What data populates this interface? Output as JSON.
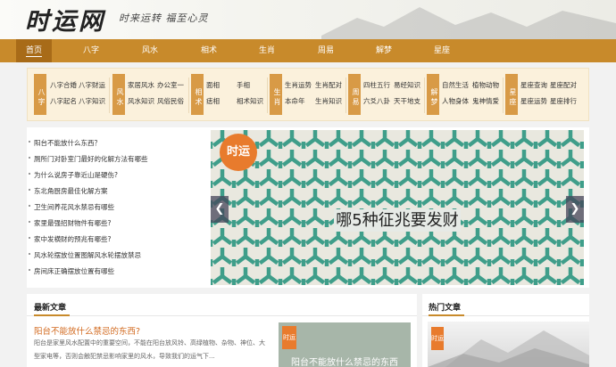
{
  "header": {
    "logo": "时运网",
    "slogan": "时来运转  福至心灵"
  },
  "nav": {
    "items": [
      "首页",
      "八字",
      "风水",
      "相术",
      "生肖",
      "周易",
      "解梦",
      "星座"
    ]
  },
  "categories": [
    {
      "tag": "八字",
      "links": [
        "八字合婚",
        "八字财运",
        "八字起名",
        "八字知识"
      ]
    },
    {
      "tag": "风水",
      "links": [
        "家居风水",
        "办公室一",
        "风水知识",
        "风俗民俗"
      ]
    },
    {
      "tag": "相术",
      "links": [
        "面相",
        "手相",
        "痣相",
        "相术知识"
      ]
    },
    {
      "tag": "生肖",
      "links": [
        "生肖运势",
        "生肖配对",
        "本命年",
        "生肖知识"
      ]
    },
    {
      "tag": "周易",
      "links": [
        "四柱五行",
        "易经知识",
        "六爻八卦",
        "天干地支"
      ]
    },
    {
      "tag": "解梦",
      "links": [
        "自然生活",
        "植物动物",
        "人物身体",
        "鬼神情爱"
      ]
    },
    {
      "tag": "星座",
      "links": [
        "星座查询",
        "星座配对",
        "星座运势",
        "星座排行"
      ]
    }
  ],
  "news": [
    "阳台不能放什么东西？",
    "厕所门对卧室门最好的化解方法有哪些",
    "为什么说房子靠近山是硬伤?",
    "东北角厨房最佳化解方案",
    "卫生间养花风水禁忌有哪些",
    "家里最强招财物件有哪些?",
    "家中发横财的预兆有哪些?",
    "风水轮摆放位置图解风水轮摆放禁忌",
    "房间床正确摆放位置有哪些"
  ],
  "banner": {
    "logo": "时运",
    "title": "哪5种征兆要发财",
    "prev": "❮",
    "next": "❯"
  },
  "latest": {
    "title": "最新文章",
    "article_title": "阳台不能放什么禁忌的东西?",
    "article_desc": "阳台是家里风水配置中的重要空间，不能在阳台放风铃、高绿植物、杂物、神位、大型家电等，否则会触犯禁忌影响家里的风水，导致我们的运气下...",
    "thumb_logo": "时运",
    "thumb_text": "阳台不能放什么禁忌的东西"
  },
  "hot": {
    "title": "热门文章",
    "logo": "时运"
  },
  "colors": {
    "accent": "#c88a2b",
    "tag": "#d89a46",
    "link_hot": "#d2691e",
    "pattern": "#3f9e8a"
  }
}
